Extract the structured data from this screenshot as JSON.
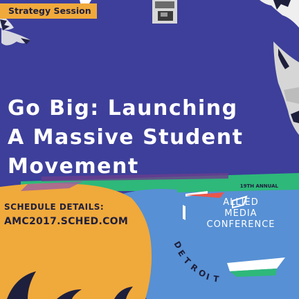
{
  "colors": {
    "background": "#3d3f9a",
    "tag": "#f0a93b",
    "orange_blob": "#f0a93b",
    "blue_blob": "#5790d4",
    "green_stripe": "#2eb87a",
    "title_text": "#ffffff",
    "dark_text": "#1e1f3c"
  },
  "tag": {
    "label": "Strategy Session"
  },
  "title": {
    "line1": "Go Big: Launching",
    "line2": "A Massive Student",
    "line3": "Movement"
  },
  "schedule": {
    "label": "SCHEDULE DETAILS:",
    "url": "AMC2017.SCHED.COM"
  },
  "conference": {
    "annual": "19TH ANNUAL",
    "line1": "ALLIED",
    "line2": "MEDIA",
    "line3": "CONFERENCE",
    "location_letters": [
      "D",
      "E",
      "T",
      "R",
      "O",
      "I",
      "T"
    ]
  },
  "icons": [
    "scribble-decoration-icon",
    "film-strip-icon",
    "tree-silhouette-icon",
    "amc-logo-icon"
  ]
}
